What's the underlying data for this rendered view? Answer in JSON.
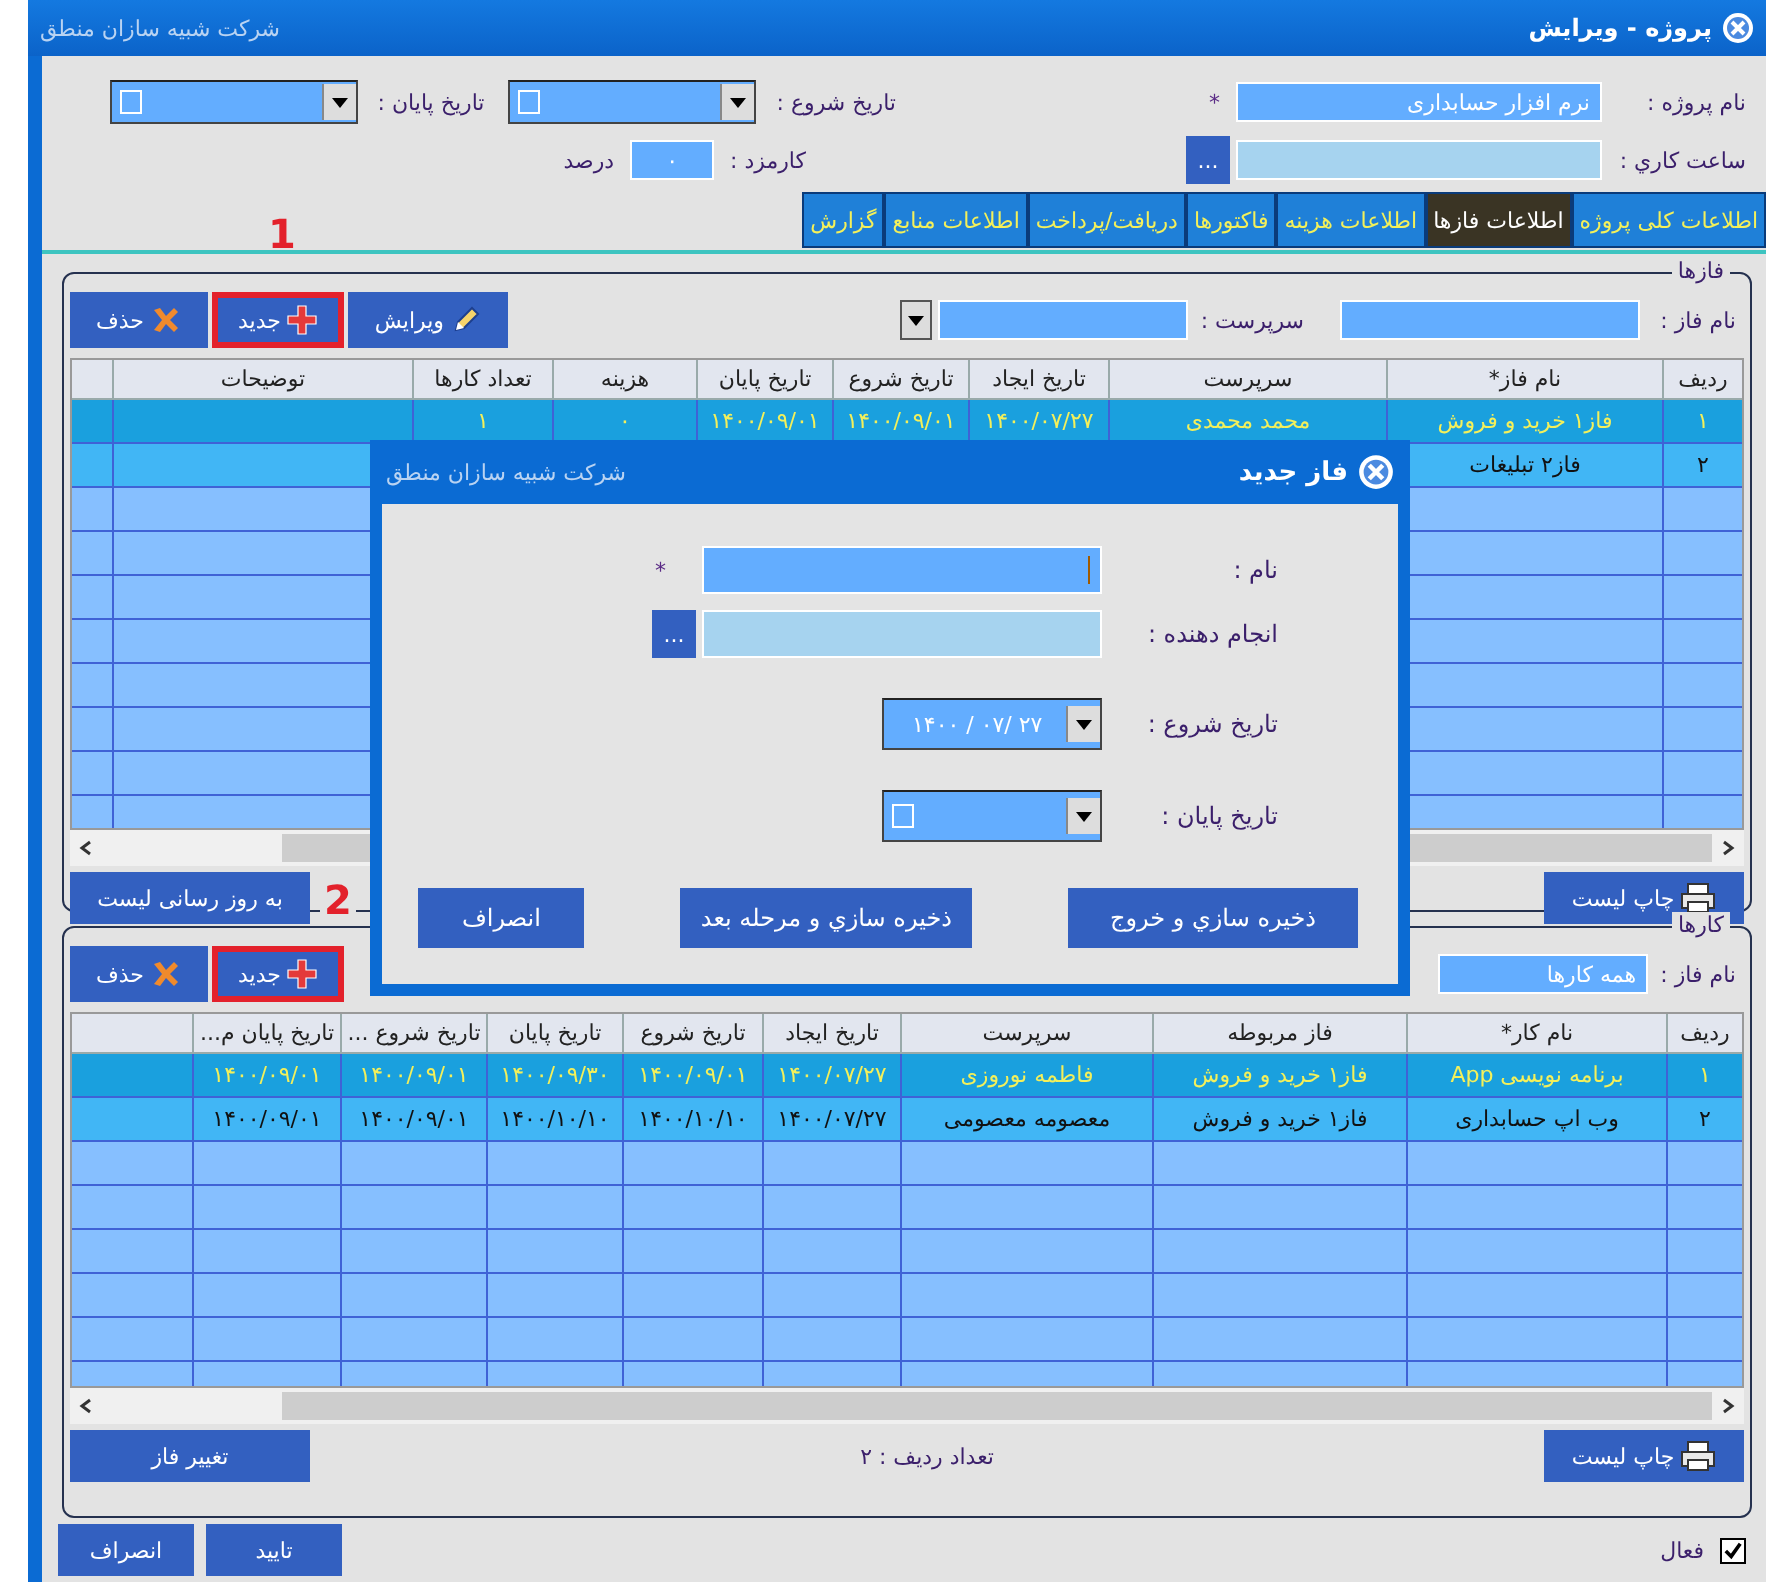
{
  "window": {
    "title": "پروژه - ویرایش",
    "company": "شرکت شبیه سازان منطق"
  },
  "project": {
    "name_label": "نام پروژه :",
    "name_value": "نرم افزار حسابداری",
    "required_mark": "*",
    "start_label": "تاریخ شروع :",
    "start_checked": false,
    "end_label": "تاریخ پایان :",
    "end_checked": false,
    "hours_label": "ساعت کاري :",
    "browse_button": "...",
    "fee_label": "کارمزد :",
    "fee_value": "۰",
    "fee_unit": "درصد"
  },
  "tabs": [
    {
      "label": "اطلاعات کلی پروژه",
      "selected": false
    },
    {
      "label": "اطلاعات فازها",
      "selected": true
    },
    {
      "label": "اطلاعات هزینه",
      "selected": false
    },
    {
      "label": "فاکتورها",
      "selected": false
    },
    {
      "label": "دریافت/پرداخت",
      "selected": false
    },
    {
      "label": "اطلاعات منابع",
      "selected": false
    },
    {
      "label": "گزارش",
      "selected": false
    }
  ],
  "phases": {
    "title": "فازها",
    "marker": "1",
    "name_label": "نام فاز :",
    "supervisor_label": "سرپرست :",
    "buttons": [
      {
        "kind": "edit",
        "label": "ویرایش",
        "highlighted": false
      },
      {
        "kind": "add",
        "label": "جدید",
        "highlighted": true
      },
      {
        "kind": "delete",
        "label": "حذف",
        "highlighted": false
      }
    ],
    "columns": [
      "ردیف",
      "نام فاز*",
      "سرپرست",
      "تاریخ ایجاد",
      "تاریخ شروع",
      "تاریخ پایان",
      "هزینه",
      "تعداد کارها",
      "توضیحات"
    ],
    "rows": [
      {
        "selected": true,
        "cells": [
          "۱",
          "فاز۱ خرید و فروش",
          "محمد محمدی",
          "۱۴۰۰/۰۷/۲۷",
          "۱۴۰۰/۰۹/۰۱",
          "۱۴۰۰/۰۹/۰۱",
          "۰",
          "۱"
        ]
      },
      {
        "selected": false,
        "cells": [
          "۲",
          "فاز۲ تبلیغات"
        ]
      }
    ],
    "print_button": "چاپ لیست",
    "refresh_button": "به روز رسانی لیست"
  },
  "tasks": {
    "title": "کارها",
    "marker": "2",
    "name_label": "نام فاز :",
    "name_value": "همه کارها",
    "buttons": [
      {
        "kind": "add",
        "label": "جدید",
        "highlighted": true
      },
      {
        "kind": "delete",
        "label": "حذف",
        "highlighted": false
      }
    ],
    "columns": [
      "ردیف",
      "نام کار*",
      "فاز مربوطه",
      "سرپرست",
      "تاریخ ایجاد",
      "تاریخ شروع",
      "تاریخ پایان",
      "تاریخ شروع ...",
      "تاریخ پایان م..."
    ],
    "rows": [
      {
        "selected": true,
        "cells": [
          "۱",
          "برنامه نویسی App",
          "فاز۱ خرید و فروش",
          "فاطمه نوروزی",
          "۱۴۰۰/۰۷/۲۷",
          "۱۴۰۰/۰۹/۰۱",
          "۱۴۰۰/۰۹/۳۰",
          "۱۴۰۰/۰۹/۰۱",
          "۱۴۰۰/۰۹/۰۱"
        ]
      },
      {
        "selected": false,
        "cells": [
          "۲",
          "وب اپ حسابداری",
          "فاز۱ خرید و فروش",
          "معصومه معصومی",
          "۱۴۰۰/۰۷/۲۷",
          "۱۴۰۰/۱۰/۱۰",
          "۱۴۰۰/۱۰/۱۰",
          "۱۴۰۰/۰۹/۰۱",
          "۱۴۰۰/۰۹/۰۱"
        ]
      }
    ],
    "print_button": "چاپ لیست",
    "row_count": "تعداد ردیف : ۲",
    "change_button": "تغییر فاز"
  },
  "footer": {
    "active_label": "فعال",
    "active_checked": true,
    "buttons": [
      "تایید",
      "انصراف"
    ]
  },
  "dialog": {
    "title": "فاز جدید",
    "company": "شرکت شبیه سازان منطق",
    "fields": [
      {
        "kind": "text",
        "label": "نام :",
        "required_mark": "*",
        "focused": true
      },
      {
        "kind": "browse",
        "label": "انجام دهنده :",
        "button": "..."
      },
      {
        "kind": "date",
        "label": "تاریخ شروع :",
        "value": "۱۴۰۰ / ۰۷/ ۲۷"
      },
      {
        "kind": "date",
        "label": "تاریخ پایان :",
        "checked": false
      }
    ],
    "buttons": [
      "ذخیره سازي و خروج",
      "ذخیره سازي و مرحله بعد",
      "انصراف"
    ]
  }
}
